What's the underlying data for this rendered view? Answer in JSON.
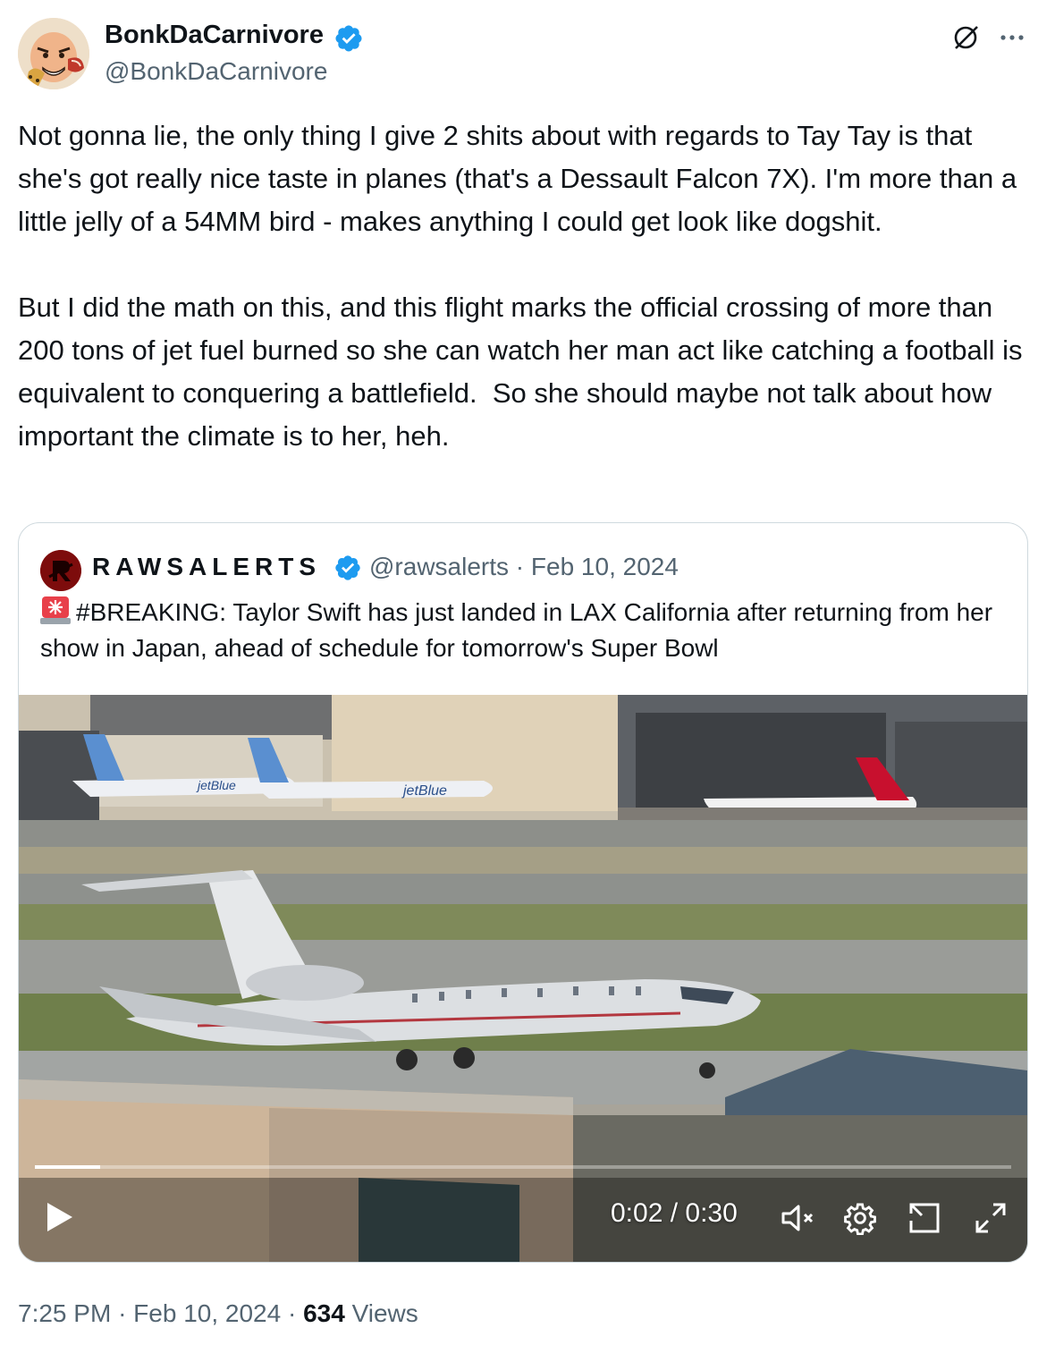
{
  "author": {
    "display_name": "BonkDaCarnivore",
    "handle": "@BonkDaCarnivore",
    "verified": true
  },
  "tweet": {
    "text": "Not gonna lie, the only thing I give 2 shits about with regards to Tay Tay is that she's got really nice taste in planes (that's a Dessault Falcon 7X). I'm more than a little jelly of a 54MM bird - makes anything I could get look like dogshit.\n\nBut I did the math on this, and this flight marks the official crossing of more than 200 tons of jet fuel burned so she can watch her man act like catching a football is equivalent to conquering a battlefield.  So she should maybe not talk about how important the climate is to her, heh.",
    "time": "7:25 PM",
    "date": "Feb 10, 2024",
    "views_count": "634",
    "views_label": "Views",
    "separator": "·"
  },
  "quoted_tweet": {
    "display_name": "RAWSALERTS",
    "handle": "@rawsalerts",
    "separator": "·",
    "date": "Feb 10, 2024",
    "verified": true,
    "text": "#BREAKING: Taylor Swift has just landed in LAX California after returning from her show in Japan, ahead of schedule for tomorrow's Super Bowl",
    "emoji_icon": "rotating-light-icon"
  },
  "video": {
    "current_time": "0:02",
    "duration": "0:30",
    "time_separator": " / ",
    "progress": 0.067,
    "muted": true,
    "aircraft_text": [
      "jetBlue",
      "jetBlue"
    ]
  },
  "icons": {
    "grok": "grok-icon",
    "more": "more-icon",
    "play": "play-icon",
    "mute": "volume-muted-icon",
    "settings": "gear-icon",
    "pip": "pip-icon",
    "fullscreen": "fullscreen-icon"
  },
  "colors": {
    "verified_blue": "#1d9bf0",
    "secondary_text": "#536471",
    "border": "#cfd9de"
  }
}
